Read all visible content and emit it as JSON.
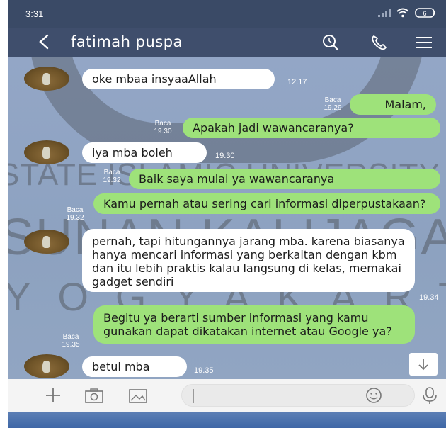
{
  "status_bar": {
    "time": "3:31"
  },
  "header": {
    "contact_name": "fatimah puspa"
  },
  "watermark": {
    "line1": "STATE ISLAMIC UNIVERSITY",
    "line2": "SUNAN KALIJAGA",
    "line3": "YOGYAKARTA"
  },
  "messages": [
    {
      "dir": "in",
      "text": "oke mbaa insyaaAllah",
      "time": "12.17"
    },
    {
      "dir": "out",
      "text": "Malam,",
      "read": "Baca",
      "time": "19.29"
    },
    {
      "dir": "out",
      "text": "Apakah jadi wawancaranya?",
      "read": "Baca",
      "time": "19.30"
    },
    {
      "dir": "in",
      "text": "iya mba boleh",
      "time": "19.30"
    },
    {
      "dir": "out",
      "text": "Baik saya mulai ya wawancaranya",
      "read": "Baca",
      "time": "19.32"
    },
    {
      "dir": "out",
      "text": "Kamu pernah atau sering cari informasi diperpustakaan?",
      "read": "Baca",
      "time": "19.32"
    },
    {
      "dir": "in",
      "text": "pernah, tapi hitungannya jarang mba. karena biasanya hanya mencari informasi yang berkaitan dengan kbm dan itu lebih praktis kalau langsung di kelas, memakai gadget sendiri",
      "time": "19.34"
    },
    {
      "dir": "out",
      "text": "Begitu ya berarti sumber informasi yang kamu gunakan dapat dikatakan internet atau Google ya?",
      "read": "Baca",
      "time": "19.35"
    },
    {
      "dir": "in",
      "text": "betul mba",
      "time": "19.35"
    }
  ],
  "icons": {
    "back": "back-arrow-icon",
    "search": "search-icon",
    "call": "phone-icon",
    "menu": "menu-icon",
    "plus": "plus-icon",
    "camera": "camera-icon",
    "gallery": "image-icon",
    "emoji": "emoji-icon",
    "mic": "microphone-icon",
    "scroll": "arrow-down-icon"
  },
  "colors": {
    "header": "#3f4e6c",
    "outgoing": "#9ee27a",
    "incoming": "#ffffff",
    "chat_bg": "#8fa3c2"
  }
}
